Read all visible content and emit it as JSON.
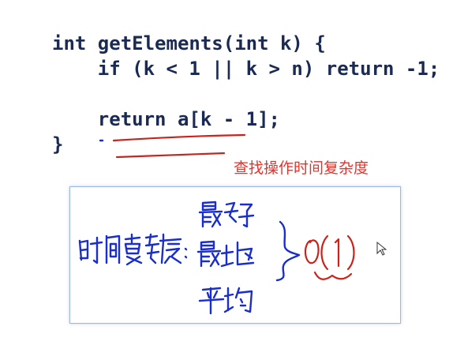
{
  "code": {
    "lines": [
      "int getElements(int k) {",
      "    if (k < 1 || k > n) return -1;",
      "",
      "    return a[k - 1];",
      "}"
    ]
  },
  "caption": "查找操作时间复杂度",
  "colors": {
    "code": "#1a2a52",
    "caption": "#e8322a",
    "ink_blue": "#1a2ecc",
    "ink_red": "#c8241e",
    "box_border": "#9db8e0"
  },
  "handwriting": {
    "left_word": "时间复杂度",
    "case_best": "最好",
    "case_worst": "最坏",
    "case_average": "平均",
    "result": "O(1)"
  },
  "cursor_icon": "mouse-pointer-icon"
}
